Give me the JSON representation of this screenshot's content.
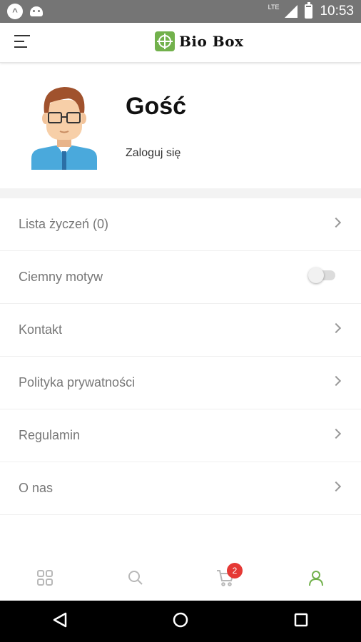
{
  "status_bar": {
    "network": "LTE",
    "time": "10:53"
  },
  "app_bar": {
    "logo_text": "Bio Box",
    "brand_color": "#72b14c"
  },
  "profile": {
    "name": "Gość",
    "login_label": "Zaloguj się"
  },
  "menu": {
    "items": [
      {
        "label": "Lista życzeń (0)",
        "control": "chevron"
      },
      {
        "label": "Ciemny motyw",
        "control": "toggle",
        "state": "off"
      },
      {
        "label": "Kontakt",
        "control": "chevron"
      },
      {
        "label": "Polityka prywatności",
        "control": "chevron"
      },
      {
        "label": "Regulamin",
        "control": "chevron"
      },
      {
        "label": "O nas",
        "control": "chevron"
      }
    ]
  },
  "bottom_nav": {
    "items": [
      {
        "icon": "grid-icon"
      },
      {
        "icon": "search-icon"
      },
      {
        "icon": "cart-icon",
        "badge": "2"
      },
      {
        "icon": "user-icon",
        "active": true
      }
    ],
    "active_color": "#72b14c",
    "badge_color": "#e53935"
  },
  "system_nav": {
    "buttons": [
      "back-icon",
      "home-icon",
      "recents-icon"
    ]
  }
}
